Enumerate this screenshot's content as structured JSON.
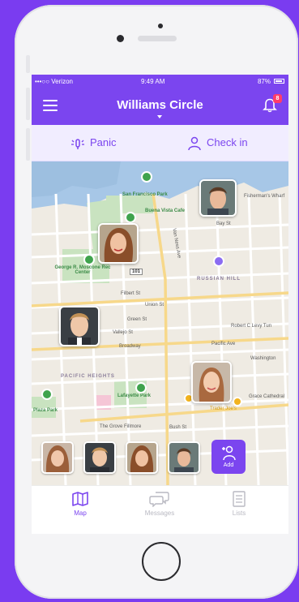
{
  "status": {
    "carrier": "•••○○ Verizon",
    "time": "9:49 AM",
    "battery": "87%"
  },
  "header": {
    "title": "Williams Circle",
    "notification_count": "8"
  },
  "actions": {
    "panic_label": "Panic",
    "checkin_label": "Check in"
  },
  "map": {
    "labels": {
      "sf_park": "San Francisco Park",
      "buena_vista": "Buena Vista Cafe",
      "fishermans": "Fisherman's Wharf",
      "george_rec": "George R. Moscone Rec Center",
      "russian_hill": "RUSSIAN HILL",
      "pacific_heights": "PACIFIC HEIGHTS",
      "lafayette_park": "Lafayette Park",
      "grove_fillmore": "The Grove Fillmore",
      "trader_joes": "Trader Joe's",
      "grace_cathedral": "Grace Cathedral",
      "plaza_park": "Plaza Park",
      "broadway": "Broadway",
      "washington": "Washington",
      "union_st": "Union St",
      "filbert_st": "Filbert St",
      "green_st": "Green St",
      "vallejo_st": "Vallejo St",
      "pacific_ave": "Pacific Ave",
      "bay_st": "Bay St",
      "van_ness": "Van Ness Ave",
      "bush_st": "Bush St",
      "robert_levy": "Robert C Levy Tun",
      "route": "101"
    }
  },
  "strip": {
    "add_label": "Add"
  },
  "tabs": [
    {
      "label": "Map",
      "active": true
    },
    {
      "label": "Messages",
      "active": false
    },
    {
      "label": "Lists",
      "active": false
    }
  ],
  "colors": {
    "accent": "#7b45ef",
    "background": "#7a3cf0"
  }
}
